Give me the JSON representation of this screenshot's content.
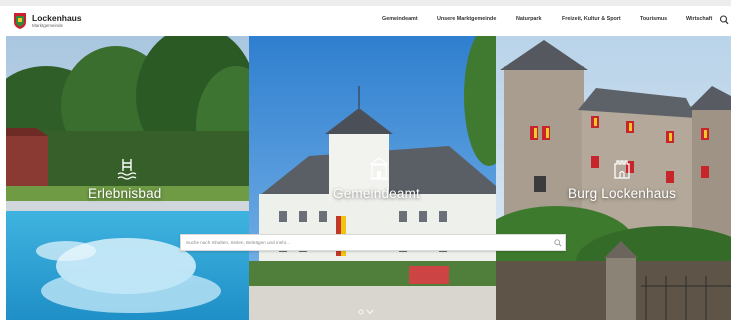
{
  "header": {
    "brand_name": "Lockenhaus",
    "brand_sub": "Marktgemeinde",
    "colors": {
      "crest_red": "#c8202e",
      "crest_green": "#2f8b3a",
      "crest_yellow": "#f3c92a"
    }
  },
  "nav": {
    "items": [
      {
        "label": "Gemeindeamt"
      },
      {
        "label": "Unsere Marktgemeinde"
      },
      {
        "label": "Naturpark"
      },
      {
        "label": "Freizeit, Kultur & Sport"
      },
      {
        "label": "Tourismus"
      },
      {
        "label": "Wirtschaft"
      }
    ],
    "search_icon": "search-icon"
  },
  "hero": {
    "panels": [
      {
        "title": "Erlebnisbad",
        "icon": "pool-icon"
      },
      {
        "title": "Gemeindeamt",
        "icon": "town-hall-icon"
      },
      {
        "title": "Burg Lockenhaus",
        "icon": "castle-icon"
      }
    ],
    "search": {
      "placeholder": "Suche nach Inhalten, Seiten, Beiträgen und mehr..."
    },
    "scroll_icon": "chevron-down-icon"
  }
}
